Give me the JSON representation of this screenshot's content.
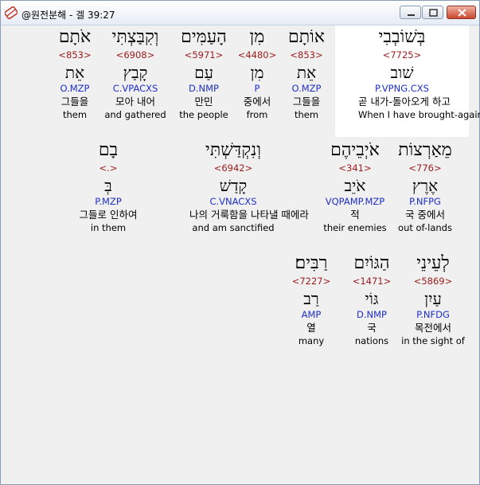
{
  "window": {
    "title": "@원전분해 - 겔 39:27",
    "buttons": {
      "minimize": "minimize",
      "maximize": "maximize",
      "close": "close"
    }
  },
  "rows": [
    [
      {
        "heb": "בְּשׁוֹבְבִי",
        "strong": "<7725>",
        "lemma": "שׁוב",
        "parse": "P.VPNG.CXS",
        "kor": "곧 내가-돌아오게 하고",
        "eng": "When I have brought-again"
      },
      {
        "heb": "אוֹתָם",
        "strong": "<853>",
        "lemma": "אֵת",
        "parse": "O.MZP",
        "kor": "그들을",
        "eng": "them"
      },
      {
        "heb": "מִן",
        "strong": "<4480>",
        "lemma": "מִן",
        "parse": "P",
        "kor": "중에서",
        "eng": "from"
      },
      {
        "heb": "הָעַמִּים",
        "strong": "<5971>",
        "lemma": "עַם",
        "parse": "D.NMP",
        "kor": "만민",
        "eng": "the people"
      },
      {
        "heb": "וְקִבַּצְתִּי",
        "strong": "<6908>",
        "lemma": "קָבַץ",
        "parse": "C.VPACXS",
        "kor": "모아 내어",
        "eng": "and gathered"
      },
      {
        "heb": "אֹתָם",
        "strong": "<853>",
        "lemma": "אֵת",
        "parse": "O.MZP",
        "kor": "그들을",
        "eng": "them"
      }
    ],
    [
      {
        "heb": "מֵאַרְצוֹת",
        "strong": "<776>",
        "lemma": "אֶרֶץ",
        "parse": "P.NFPG",
        "kor": "국 중에서",
        "eng": "out of-lands"
      },
      {
        "heb": "אֹיְבֵיהֶם",
        "strong": "<341>",
        "lemma": "אֹיֵב",
        "parse": "VQPAMP.MZP",
        "kor": "적",
        "eng": "their enemies"
      },
      {
        "heb": "וְנִקְדַּשְׁתִּי",
        "strong": "<6942>",
        "lemma": "קָדַשׁ",
        "parse": "C.VNACXS",
        "kor": "나의 거룩함을 나타낼 때에라",
        "eng": "and am sanctified"
      },
      {
        "heb": "בָם",
        "strong": "<.>",
        "lemma": "בְּ",
        "parse": "P.MZP",
        "kor": "그들로 인하여",
        "eng": "in them"
      }
    ],
    [
      {
        "heb": "לְעֵינֵי",
        "strong": "<5869>",
        "lemma": "עַיִן",
        "parse": "P.NFDG",
        "kor": "목전에서",
        "eng": "in the sight of"
      },
      {
        "heb": "הַגּוֹיִם",
        "strong": "<1471>",
        "lemma": "גּוֹי",
        "parse": "D.NMP",
        "kor": "국",
        "eng": "nations"
      },
      {
        "heb": "רַבִּים׃",
        "strong": "<7227>",
        "lemma": "רַב",
        "parse": "AMP",
        "kor": "열",
        "eng": "many"
      }
    ]
  ]
}
